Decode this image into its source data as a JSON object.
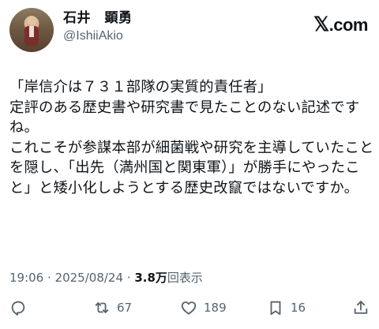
{
  "author": {
    "display_name": "石井　顕勇",
    "handle": "@IshiiAkio"
  },
  "brand": {
    "glyph": "𝕏",
    "suffix": ".com"
  },
  "post": {
    "lines": [
      "「岸信介は７３１部隊の実質的責任者」",
      "定評のある歴史書や研究書で見たことのない記述ですね。",
      "これこそが参謀本部が細菌戦や研究を主導していたことを隠し、「出先（満州国と関東軍）」が勝手にやったこと」と矮小化しようとする歴史改竄ではないですか。"
    ]
  },
  "meta": {
    "time": "19:06",
    "separator": " · ",
    "date": "2025/08/24",
    "separator2": " · ",
    "views_count": "3.8万",
    "views_label": "回表示"
  },
  "actions": {
    "reply": {
      "icon": "reply-icon",
      "count": ""
    },
    "repost": {
      "icon": "repost-icon",
      "count": "67"
    },
    "like": {
      "icon": "heart-icon",
      "count": "189"
    },
    "bookmark": {
      "icon": "bookmark-icon",
      "count": "16"
    },
    "share": {
      "icon": "share-icon",
      "count": ""
    }
  }
}
